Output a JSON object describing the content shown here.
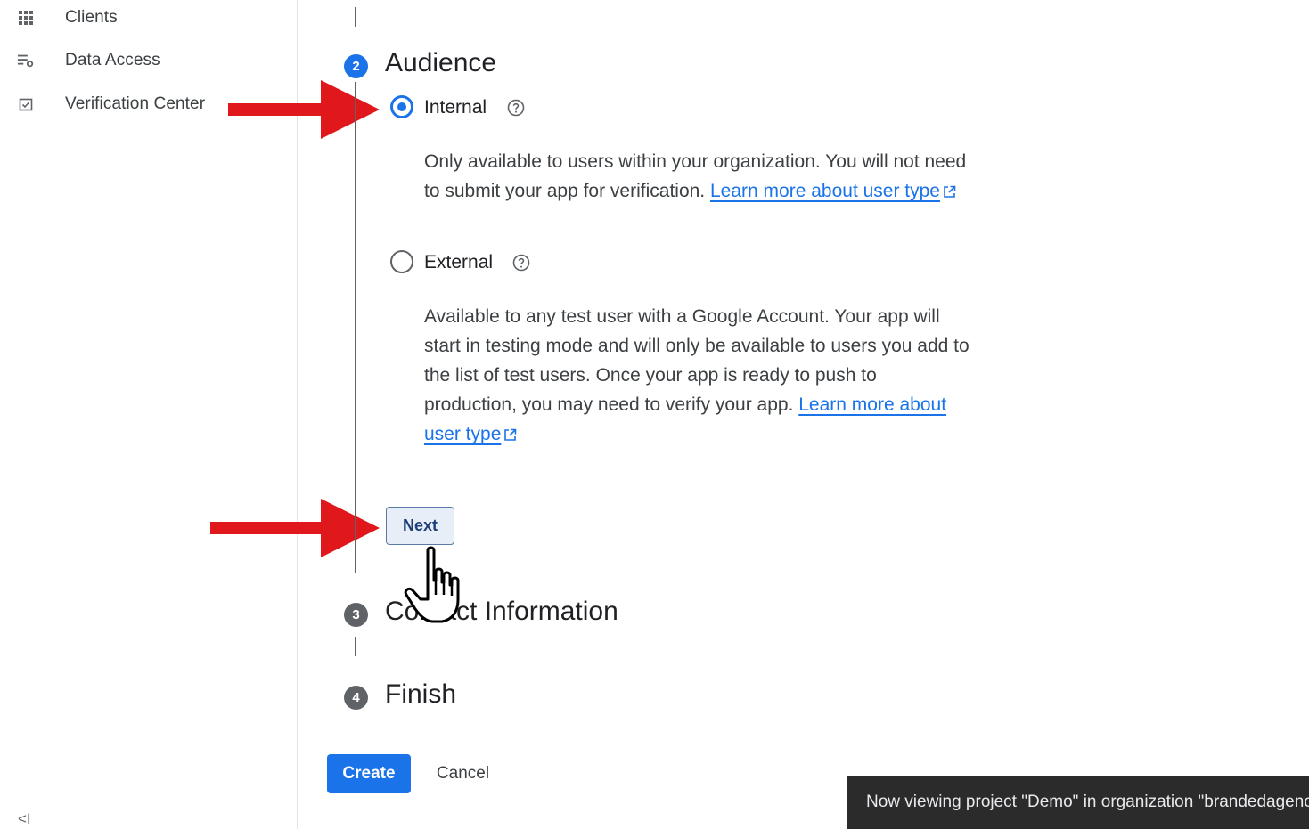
{
  "sidebar": {
    "items": [
      {
        "label": "Clients",
        "icon": "apps-grid-icon"
      },
      {
        "label": "Data Access",
        "icon": "data-access-icon"
      },
      {
        "label": "Verification Center",
        "icon": "verification-icon"
      }
    ],
    "collapse_icon": "<I"
  },
  "stepper": {
    "step2": {
      "number": "2",
      "title": "Audience",
      "state": "active"
    },
    "step3": {
      "number": "3",
      "title": "Contact Information",
      "state": "pending"
    },
    "step4": {
      "number": "4",
      "title": "Finish",
      "state": "pending"
    }
  },
  "audience": {
    "internal": {
      "label": "Internal",
      "selected": true,
      "description": "Only available to users within your organization. You will not need to submit your app for verification.",
      "link_text": "Learn more about user type"
    },
    "external": {
      "label": "External",
      "selected": false,
      "description": "Available to any test user with a Google Account. Your app will start in testing mode and will only be available to users you add to the list of test users. Once your app is ready to push to production, you may need to verify your app.",
      "link_text": "Learn more about user type"
    },
    "next_label": "Next"
  },
  "actions": {
    "create_label": "Create",
    "cancel_label": "Cancel"
  },
  "toast": {
    "message": "Now viewing project \"Demo\" in organization \"brandedagenc"
  },
  "colors": {
    "primary": "#1a73e8",
    "annotation_arrow": "#e0171b",
    "toast_bg": "#2b2b2b"
  }
}
